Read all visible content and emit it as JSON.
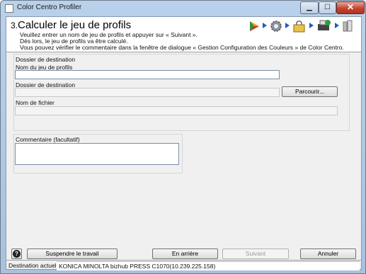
{
  "window": {
    "title": "Color Centro Profiler"
  },
  "header": {
    "step_number": "3.",
    "title": "Calculer le jeu de profils",
    "description": [
      "Veuillez entrer un nom de jeu de profils et appuyer sur « Suivant ».",
      "Dès lors, le jeu de profils va être calculé.",
      "Vous pouvez vérifier le commentaire dans la fenêtre de dialogue « Gestion Configuration des Couleurs » de Color Centro."
    ],
    "wizard_icons": [
      "play-icon",
      "gear-icon",
      "lock-package-icon",
      "printer-check-icon",
      "finish-icon"
    ]
  },
  "destination": {
    "group_label": "Dossier de destination",
    "profile_set_label": "Nom du jeu de profils",
    "profile_set_value": "",
    "folder_label": "Dossier de destination",
    "folder_value": "",
    "browse_label": "Parcourir...",
    "filename_label": "Nom de fichier",
    "filename_value": ""
  },
  "comment": {
    "label": "Commentaire (facultatif)",
    "value": ""
  },
  "footer": {
    "help_label": "?",
    "suspend_label": "Suspendre le travail",
    "back_label": "En arrière",
    "next_label": "Suivant",
    "cancel_label": "Annuler"
  },
  "status": {
    "label": "Destination actuelle",
    "value": "KONICA MINOLTA bizhub PRESS C1070(10.239.225.158)"
  },
  "colors": {
    "accent": "#1a5fbf",
    "window_frame": "#b9d1ea",
    "close": "#c4442f"
  }
}
